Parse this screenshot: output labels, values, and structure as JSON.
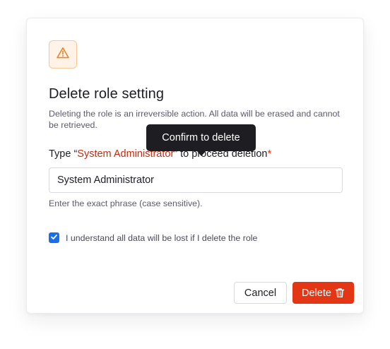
{
  "dialog": {
    "title": "Delete role setting",
    "description": "Deleting the role is an irreversible action. All data will be erased and cannot be retrieved.",
    "tooltip": "Confirm to delete",
    "field": {
      "label_prefix": "Type “",
      "phrase": "System Administrator",
      "label_suffix": "” to proceed deletion",
      "required_mark": "*",
      "value": "System Administrator",
      "hint": "Enter the exact phrase (case sensitive)."
    },
    "checkbox": {
      "checked": true,
      "label": "I understand all data will be lost if I delete the role"
    },
    "buttons": {
      "cancel_label": "Cancel",
      "delete_label": "Delete"
    },
    "icons": {
      "warning": "warning-triangle-icon",
      "check": "check-icon",
      "trash": "trash-icon"
    },
    "colors": {
      "danger": "#e23614",
      "danger_text": "#c8290f",
      "warning": "#e8862a",
      "warning_bg": "#fff3e8",
      "checkbox": "#1a6fe8",
      "tooltip_bg": "#1e1e22"
    }
  }
}
